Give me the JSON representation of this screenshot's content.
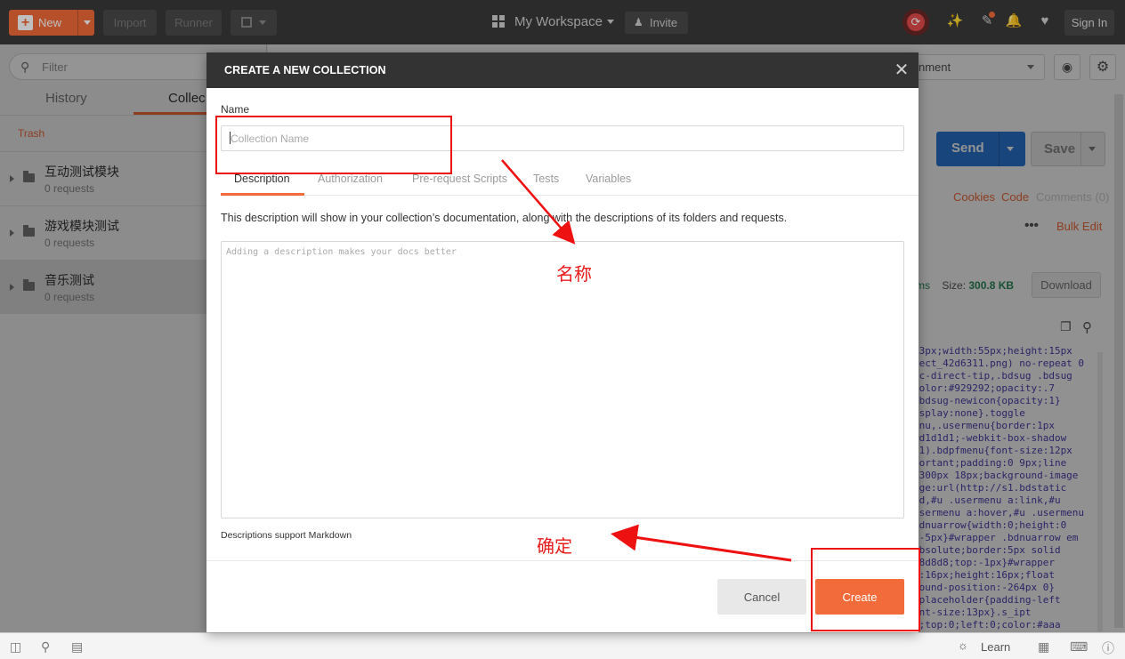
{
  "header": {
    "new_label": "New",
    "import_label": "Import",
    "runner_label": "Runner",
    "workspace_label": "My Workspace",
    "invite_label": "Invite",
    "signin_label": "Sign In"
  },
  "sidebar": {
    "filter_placeholder": "Filter",
    "tabs": [
      "History",
      "Collec"
    ],
    "trash_label": "Trash",
    "collections": [
      {
        "name": "互动测试模块",
        "count": "0 requests"
      },
      {
        "name": "游戏模块测试",
        "count": "0 requests"
      },
      {
        "name": "音乐测试",
        "count": "0 requests"
      }
    ]
  },
  "main": {
    "environment_label": "nment",
    "send_label": "Send",
    "save_label": "Save",
    "cookies_label": "Cookies",
    "code_label": "Code",
    "comments_label": "Comments (0)",
    "bulk_edit_label": "Bulk Edit",
    "response_time_fragment": "ms",
    "size_label": "Size:",
    "size_value": "300.8 KB",
    "download_label": "Download",
    "code_text": ":3px;width:55px;height:15px\nrect_42d6311.png) no-repeat 0\npc-direct-tip,.bdsug .bdsug\ncolor:#929292;opacity:.7\n.bdsug-newicon{opacity:1}\n.splay:none}.toggle\nenu,.usermenu{border:1px\n#d1d1d1;-webkit-box-shadow\nd1).bdpfmenu{font-size:12px\nportant;padding:0 9px;line\n:300px 18px;background-image\nage:url(http://s1.bdstatic\ned,#u .usermenu a:link,#u\nusermenu a:hover,#u .usermenu\nbdnuarrow{width:0;height:0\n:-5px}#wrapper .bdnuarrow em\nabsolute;border:5px solid\nd8d8d8;top:-1px}#wrapper\nn:16px;height:16px;float\nround-position:-264px 0}\n-placeholder{padding-left\nont-size:13px}.s_ipt\ne;top:0;left:0;color:#aaa"
  },
  "modal": {
    "title": "CREATE A NEW COLLECTION",
    "name_label": "Name",
    "name_placeholder": "Collection Name",
    "name_value": "",
    "tabs": [
      "Description",
      "Authorization",
      "Pre-request Scripts",
      "Tests",
      "Variables"
    ],
    "active_tab": "Description",
    "description_help": "This description will show in your collection’s documentation, along with the descriptions of its folders and requests.",
    "description_placeholder": "Adding a description makes your docs better",
    "markdown_note": "Descriptions support Markdown",
    "cancel_label": "Cancel",
    "create_label": "Create"
  },
  "statusbar": {
    "learn_label": "Learn"
  },
  "annotations": {
    "name_note": "名称",
    "confirm_note": "确定"
  },
  "colors": {
    "accent": "#f26b3a",
    "header_bg": "#3a3a3a",
    "send_blue": "#2a77d6",
    "annotation_red": "#e81b1b"
  },
  "icons": [
    "plus-icon",
    "grid-icon",
    "add-user-icon",
    "sync-icon",
    "satellite-icon",
    "notification-icon",
    "bell-icon",
    "heart-icon",
    "search-icon",
    "folder-icon",
    "eye-icon",
    "gear-icon",
    "copy-icon",
    "close-icon",
    "sidebar-toggle-icon",
    "find-icon",
    "console-icon",
    "lightbulb-icon",
    "two-pane-icon",
    "help-icon"
  ]
}
